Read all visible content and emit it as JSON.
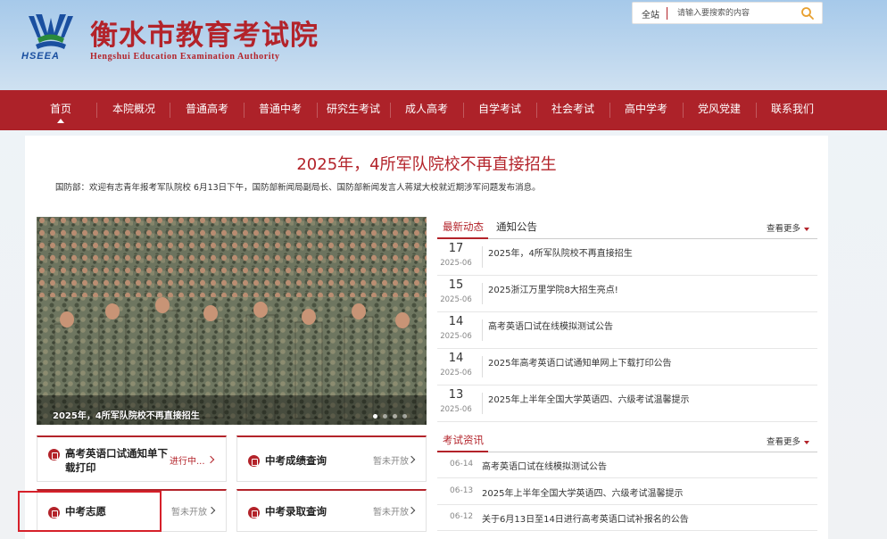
{
  "header": {
    "title_cn": "衡水市教育考试院",
    "title_en": "Hengshui Education Examination Authority",
    "abbr": "HSEEA",
    "search": {
      "scope": "全站",
      "placeholder": "请输入要搜索的内容"
    }
  },
  "nav": {
    "items": [
      {
        "label": "首页"
      },
      {
        "label": "本院概况"
      },
      {
        "label": "普通高考"
      },
      {
        "label": "普通中考"
      },
      {
        "label": "研究生考试"
      },
      {
        "label": "成人高考"
      },
      {
        "label": "自学考试"
      },
      {
        "label": "社会考试"
      },
      {
        "label": "高中学考"
      },
      {
        "label": "党风党建"
      },
      {
        "label": "联系我们"
      }
    ]
  },
  "headline": {
    "title": "2025年，4所军队院校不再直接招生",
    "summary": "国防部：欢迎有志青年报考军队院校 6月13日下午，国防部新闻局副局长、国防部新闻发言人蒋斌大校就近期涉军问题发布消息。"
  },
  "slideshow": {
    "caption": "2025年，4所军队院校不再直接招生"
  },
  "news": {
    "tabs": [
      {
        "label": "最新动态"
      },
      {
        "label": "通知公告"
      }
    ],
    "more": "查看更多",
    "items": [
      {
        "day": "17",
        "ym": "2025-06",
        "title": "2025年，4所军队院校不再直接招生"
      },
      {
        "day": "15",
        "ym": "2025-06",
        "title": "2025浙江万里学院8大招生亮点!"
      },
      {
        "day": "14",
        "ym": "2025-06",
        "title": "高考英语口试在线模拟测试公告"
      },
      {
        "day": "14",
        "ym": "2025-06",
        "title": "2025年高考英语口试通知单网上下载打印公告"
      },
      {
        "day": "13",
        "ym": "2025-06",
        "title": "2025年上半年全国大学英语四、六级考试温馨提示"
      }
    ]
  },
  "exam_info": {
    "tab": "考试资讯",
    "more": "查看更多",
    "items": [
      {
        "date": "06-14",
        "title": "高考英语口试在线模拟测试公告"
      },
      {
        "date": "06-13",
        "title": "2025年上半年全国大学英语四、六级考试温馨提示"
      },
      {
        "date": "06-12",
        "title": "关于6月13日至14日进行高考英语口试补报名的公告"
      }
    ]
  },
  "services": [
    {
      "title": "高考英语口试通知单下载打印",
      "status": "进行中..."
    },
    {
      "title": "中考成绩查询",
      "status": "暂未开放"
    },
    {
      "title": "中考志愿",
      "status": "暂未开放"
    },
    {
      "title": "中考录取查询",
      "status": "暂未开放"
    }
  ],
  "colors": {
    "brand_red": "#ad2229",
    "accent_red": "#b3232a",
    "logo_blue": "#1a4fa0"
  }
}
